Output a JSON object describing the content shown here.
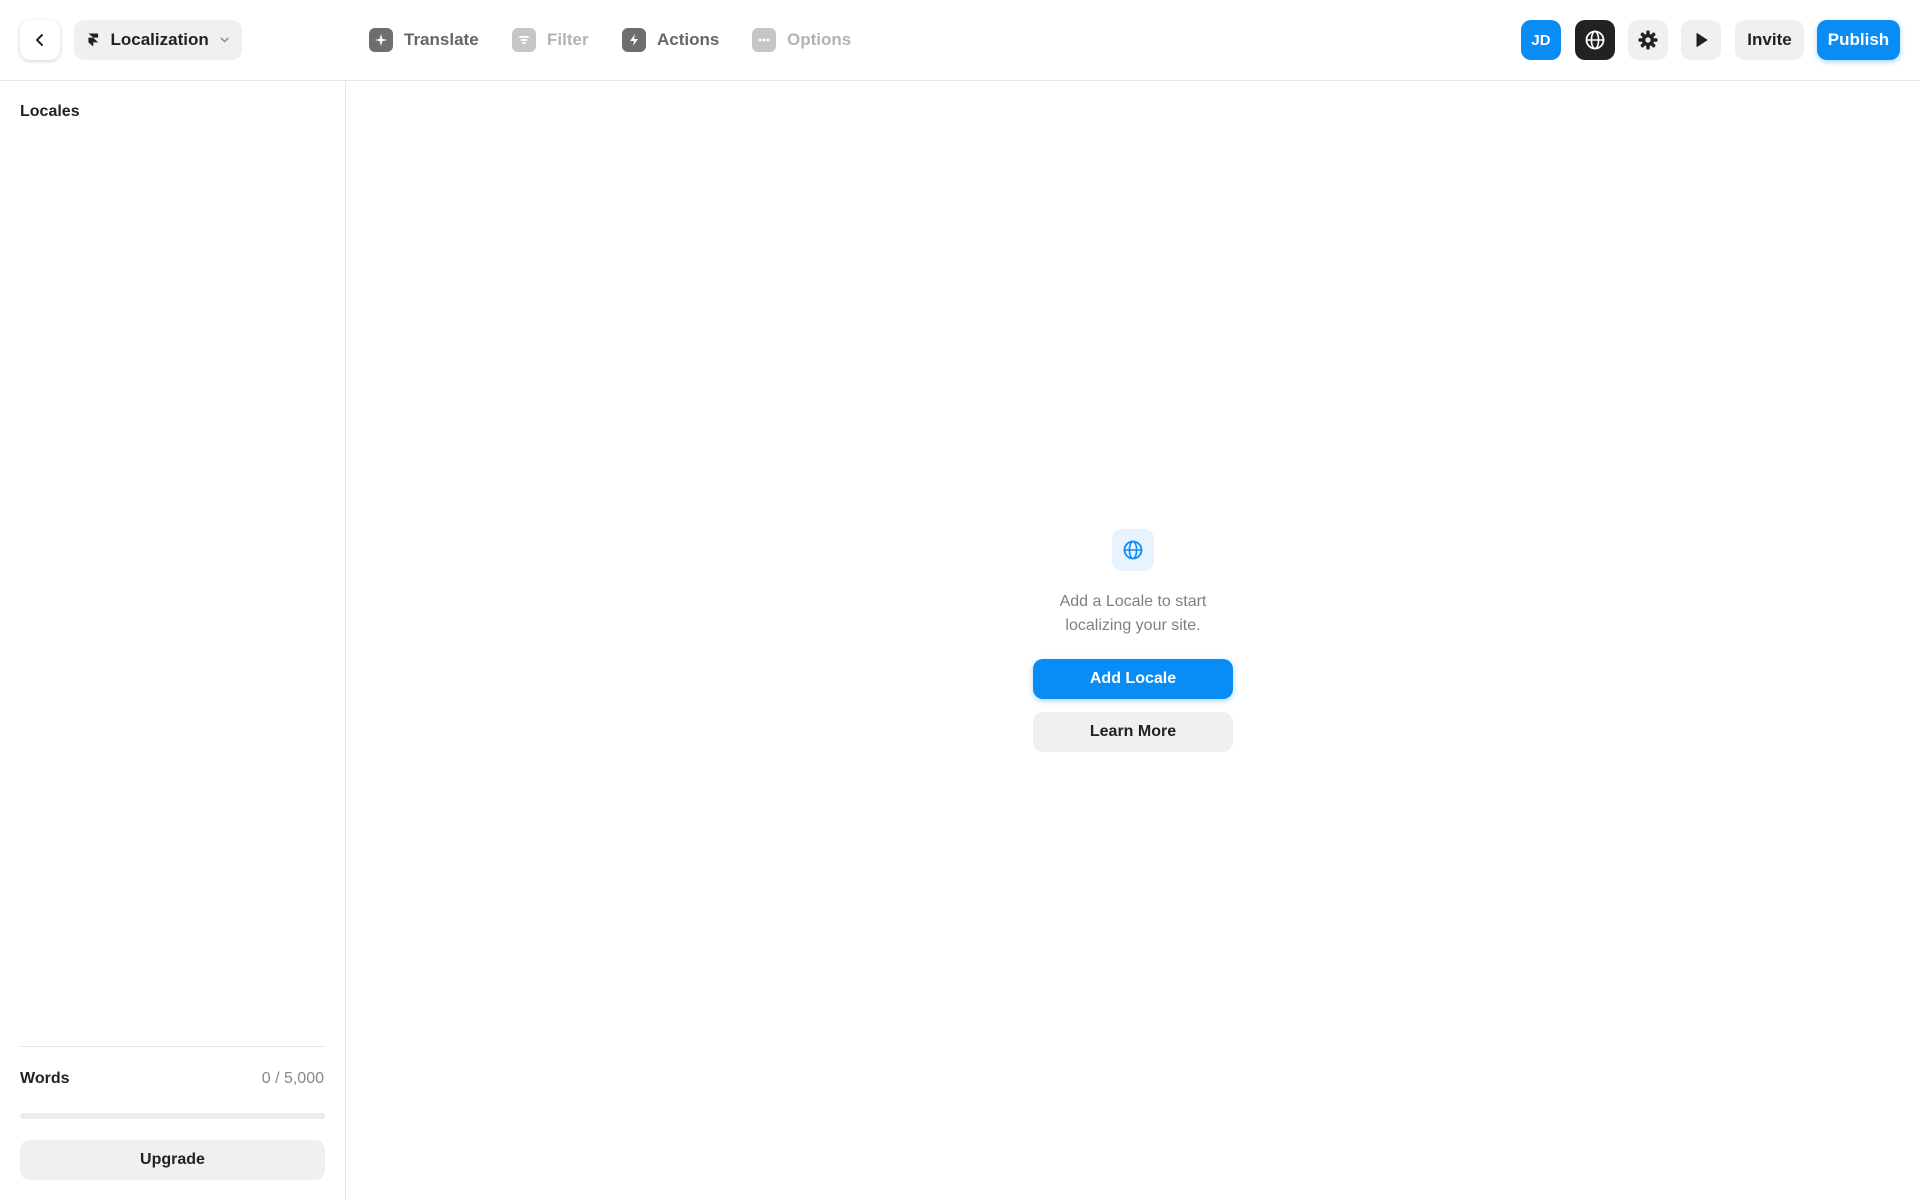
{
  "header": {
    "project_name": "Localization",
    "toolbar": [
      {
        "label": "Translate",
        "icon": "sparkle-icon",
        "enabled": true
      },
      {
        "label": "Filter",
        "icon": "filter-icon",
        "enabled": false
      },
      {
        "label": "Actions",
        "icon": "bolt-icon",
        "enabled": true
      },
      {
        "label": "Options",
        "icon": "more-icon",
        "enabled": false
      }
    ],
    "avatar_initials": "JD",
    "invite_label": "Invite",
    "publish_label": "Publish"
  },
  "sidebar": {
    "title": "Locales",
    "words_label": "Words",
    "words_count": "0 / 5,000",
    "words_progress": 0,
    "upgrade_label": "Upgrade"
  },
  "main": {
    "empty_message": "Add a Locale to start localizing your site.",
    "add_locale_label": "Add Locale",
    "learn_more_label": "Learn More"
  },
  "colors": {
    "accent": "#0a8cf5",
    "dark_button": "#222222",
    "secondary_button": "#f0f0f0"
  }
}
